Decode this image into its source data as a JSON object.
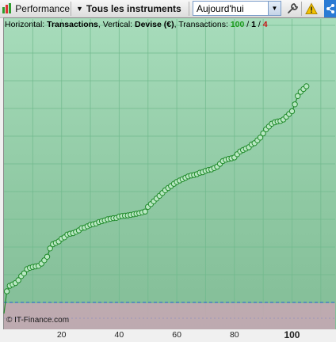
{
  "toolbar": {
    "performance_label": "Performance",
    "instruments_label": "Tous les instruments",
    "period_value": "Aujourd'hui",
    "icons": [
      "bar-chart-icon",
      "chevron-down-icon",
      "wrench-icon",
      "warning-icon",
      "share-icon"
    ]
  },
  "header": {
    "horizontal_prefix": "Horizontal: ",
    "horizontal_value": "Transactions",
    "vertical_prefix": ", Vertical: ",
    "vertical_value": "Devise (€)",
    "transactions_prefix": ", Transactions: ",
    "count_total": "100",
    "sep1": " / ",
    "count_green": "1",
    "sep2": " / ",
    "count_red": "4"
  },
  "copyright": "© IT-Finance.com",
  "colors": {
    "line": "#1f8a2a",
    "marker_fill": "#b9e8c3",
    "grid": "#6fb98c",
    "baseline_dash": "#2f5fd8",
    "lower_band": "#c8a7b4"
  },
  "chart_data": {
    "type": "line",
    "xlabel": "",
    "ylabel": "",
    "xlim": [
      0,
      115
    ],
    "ylim": [
      0,
      100
    ],
    "x_ticks": [
      20,
      40,
      60,
      80,
      100
    ],
    "x_tick_labels": [
      "20",
      "40",
      "60",
      "80",
      "100"
    ],
    "bold_tick": "100",
    "baseline_y": 0,
    "series": [
      {
        "name": "",
        "x": [
          1,
          2,
          3,
          4,
          5,
          6,
          7,
          8,
          9,
          10,
          11,
          12,
          13,
          14,
          15,
          16,
          17,
          18,
          19,
          20,
          21,
          22,
          23,
          24,
          25,
          26,
          27,
          28,
          29,
          30,
          31,
          32,
          33,
          34,
          35,
          36,
          37,
          38,
          39,
          40,
          41,
          42,
          43,
          44,
          45,
          46,
          47,
          48,
          49,
          50,
          51,
          52,
          53,
          54,
          55,
          56,
          57,
          58,
          59,
          60,
          61,
          62,
          63,
          64,
          65,
          66,
          67,
          68,
          69,
          70,
          71,
          72,
          73,
          74,
          75,
          76,
          77,
          78,
          79,
          80,
          81,
          82,
          83,
          84,
          85,
          86,
          87,
          88,
          89,
          90,
          91,
          92,
          93,
          94,
          95,
          96,
          97,
          98,
          99,
          100,
          101,
          102,
          103,
          104,
          105
        ],
        "values": [
          4,
          6,
          6.5,
          7,
          8,
          9.5,
          10.5,
          12,
          12.5,
          12.8,
          13,
          13.2,
          14,
          15.2,
          16.5,
          19.5,
          21,
          21.5,
          22,
          23,
          23.5,
          24.5,
          24.8,
          25,
          25.5,
          26,
          26.8,
          27,
          27.5,
          28,
          28.2,
          28.5,
          29,
          29.3,
          29.6,
          30,
          30.2,
          30.4,
          30.5,
          31,
          31.2,
          31.3,
          31.4,
          31.6,
          31.8,
          32,
          32.2,
          32.5,
          32.8,
          34.5,
          35.5,
          36.5,
          37.5,
          38.5,
          39.5,
          40.5,
          41.3,
          42,
          42.8,
          43.5,
          44,
          44.5,
          45,
          45.5,
          45.8,
          46,
          46.3,
          46.8,
          47,
          47.5,
          47.8,
          48,
          48.5,
          49,
          50,
          51,
          51.5,
          51.8,
          52,
          52.3,
          53.5,
          54.5,
          55,
          55.5,
          56,
          57,
          57.5,
          58.5,
          59.5,
          61,
          62.5,
          63.5,
          64.5,
          65,
          65.3,
          65.5,
          66,
          67,
          68,
          69,
          71.5,
          74.5,
          76,
          77,
          78
        ]
      }
    ]
  }
}
